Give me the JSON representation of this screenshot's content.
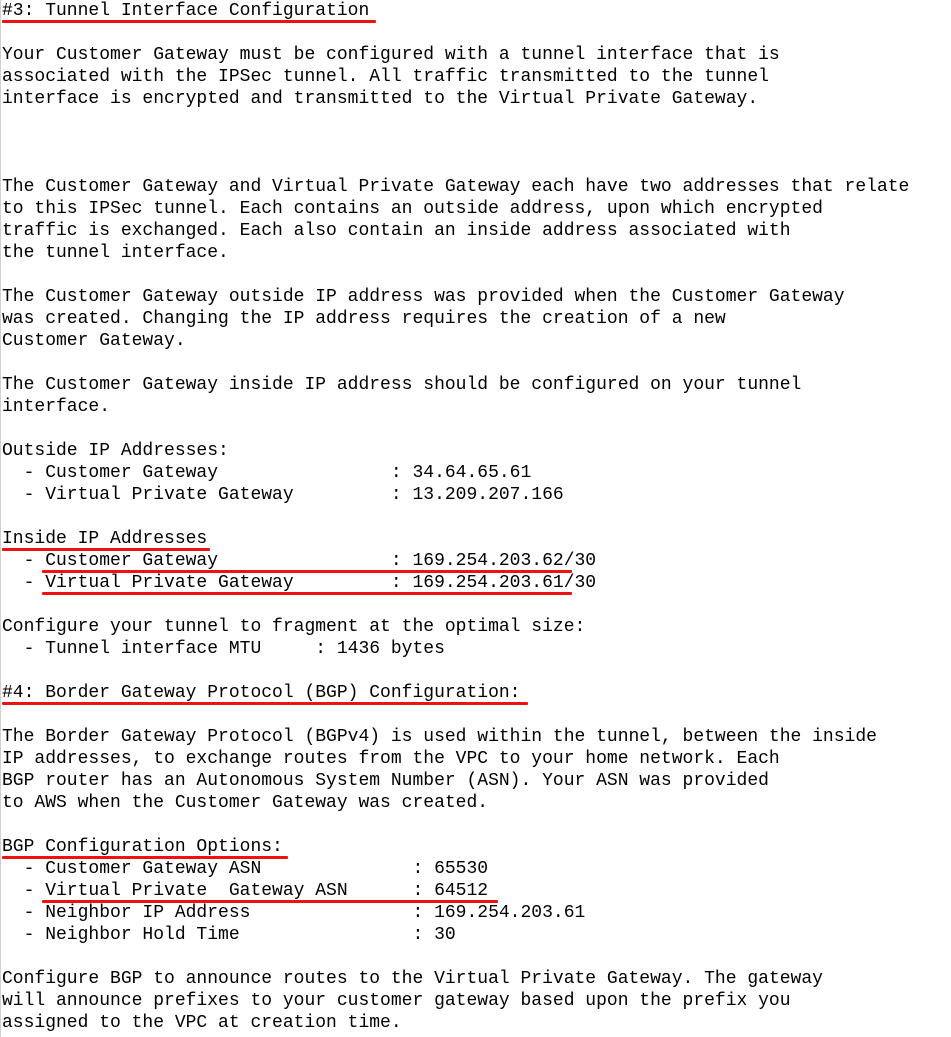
{
  "accent_color": "#ee1111",
  "lines": [
    "#3: Tunnel Interface Configuration",
    "",
    "Your Customer Gateway must be configured with a tunnel interface that is",
    "associated with the IPSec tunnel. All traffic transmitted to the tunnel",
    "interface is encrypted and transmitted to the Virtual Private Gateway.",
    "",
    "",
    "",
    "The Customer Gateway and Virtual Private Gateway each have two addresses that relate",
    "to this IPSec tunnel. Each contains an outside address, upon which encrypted",
    "traffic is exchanged. Each also contain an inside address associated with",
    "the tunnel interface.",
    "",
    "The Customer Gateway outside IP address was provided when the Customer Gateway",
    "was created. Changing the IP address requires the creation of a new",
    "Customer Gateway.",
    "",
    "The Customer Gateway inside IP address should be configured on your tunnel",
    "interface.",
    "",
    "Outside IP Addresses:",
    "  - Customer Gateway                : 34.64.65.61",
    "  - Virtual Private Gateway         : 13.209.207.166",
    "",
    "Inside IP Addresses",
    "  - Customer Gateway                : 169.254.203.62/30",
    "  - Virtual Private Gateway         : 169.254.203.61/30",
    "",
    "Configure your tunnel to fragment at the optimal size:",
    "  - Tunnel interface MTU     : 1436 bytes",
    "",
    "#4: Border Gateway Protocol (BGP) Configuration:",
    "",
    "The Border Gateway Protocol (BGPv4) is used within the tunnel, between the inside",
    "IP addresses, to exchange routes from the VPC to your home network. Each",
    "BGP router has an Autonomous System Number (ASN). Your ASN was provided",
    "to AWS when the Customer Gateway was created.",
    "",
    "BGP Configuration Options:",
    "  - Customer Gateway ASN              : 65530",
    "  - Virtual Private  Gateway ASN      : 64512",
    "  - Neighbor IP Address               : 169.254.203.61",
    "  - Neighbor Hold Time                : 30",
    "",
    "Configure BGP to announce routes to the Virtual Private Gateway. The gateway",
    "will announce prefixes to your customer gateway based upon the prefix you",
    "assigned to the VPC at creation time."
  ]
}
